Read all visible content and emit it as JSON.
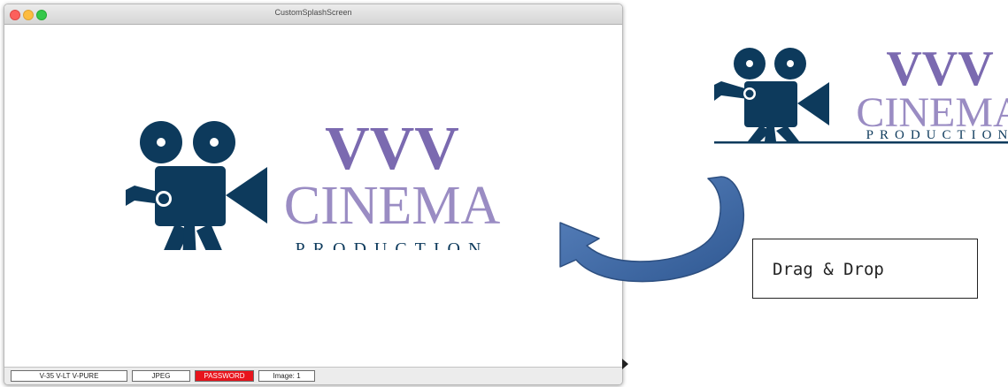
{
  "window": {
    "title": "CustomSplashScreen"
  },
  "logo": {
    "line1": "VVV",
    "line2": "CINEMA",
    "line3": "PRODUCTION",
    "colors": {
      "navy": "#0d3a5c",
      "purple_dark": "#7b6ab0",
      "purple_light": "#9a8cc3"
    }
  },
  "statusbar": {
    "engines": "V-35  V-LT  V-PURE",
    "format": "JPEG",
    "password": "PASSWORD",
    "image": "Image: 1"
  },
  "annotation": {
    "drag_label": "Drag & Drop",
    "arrow_color": "#3f6aa6"
  }
}
